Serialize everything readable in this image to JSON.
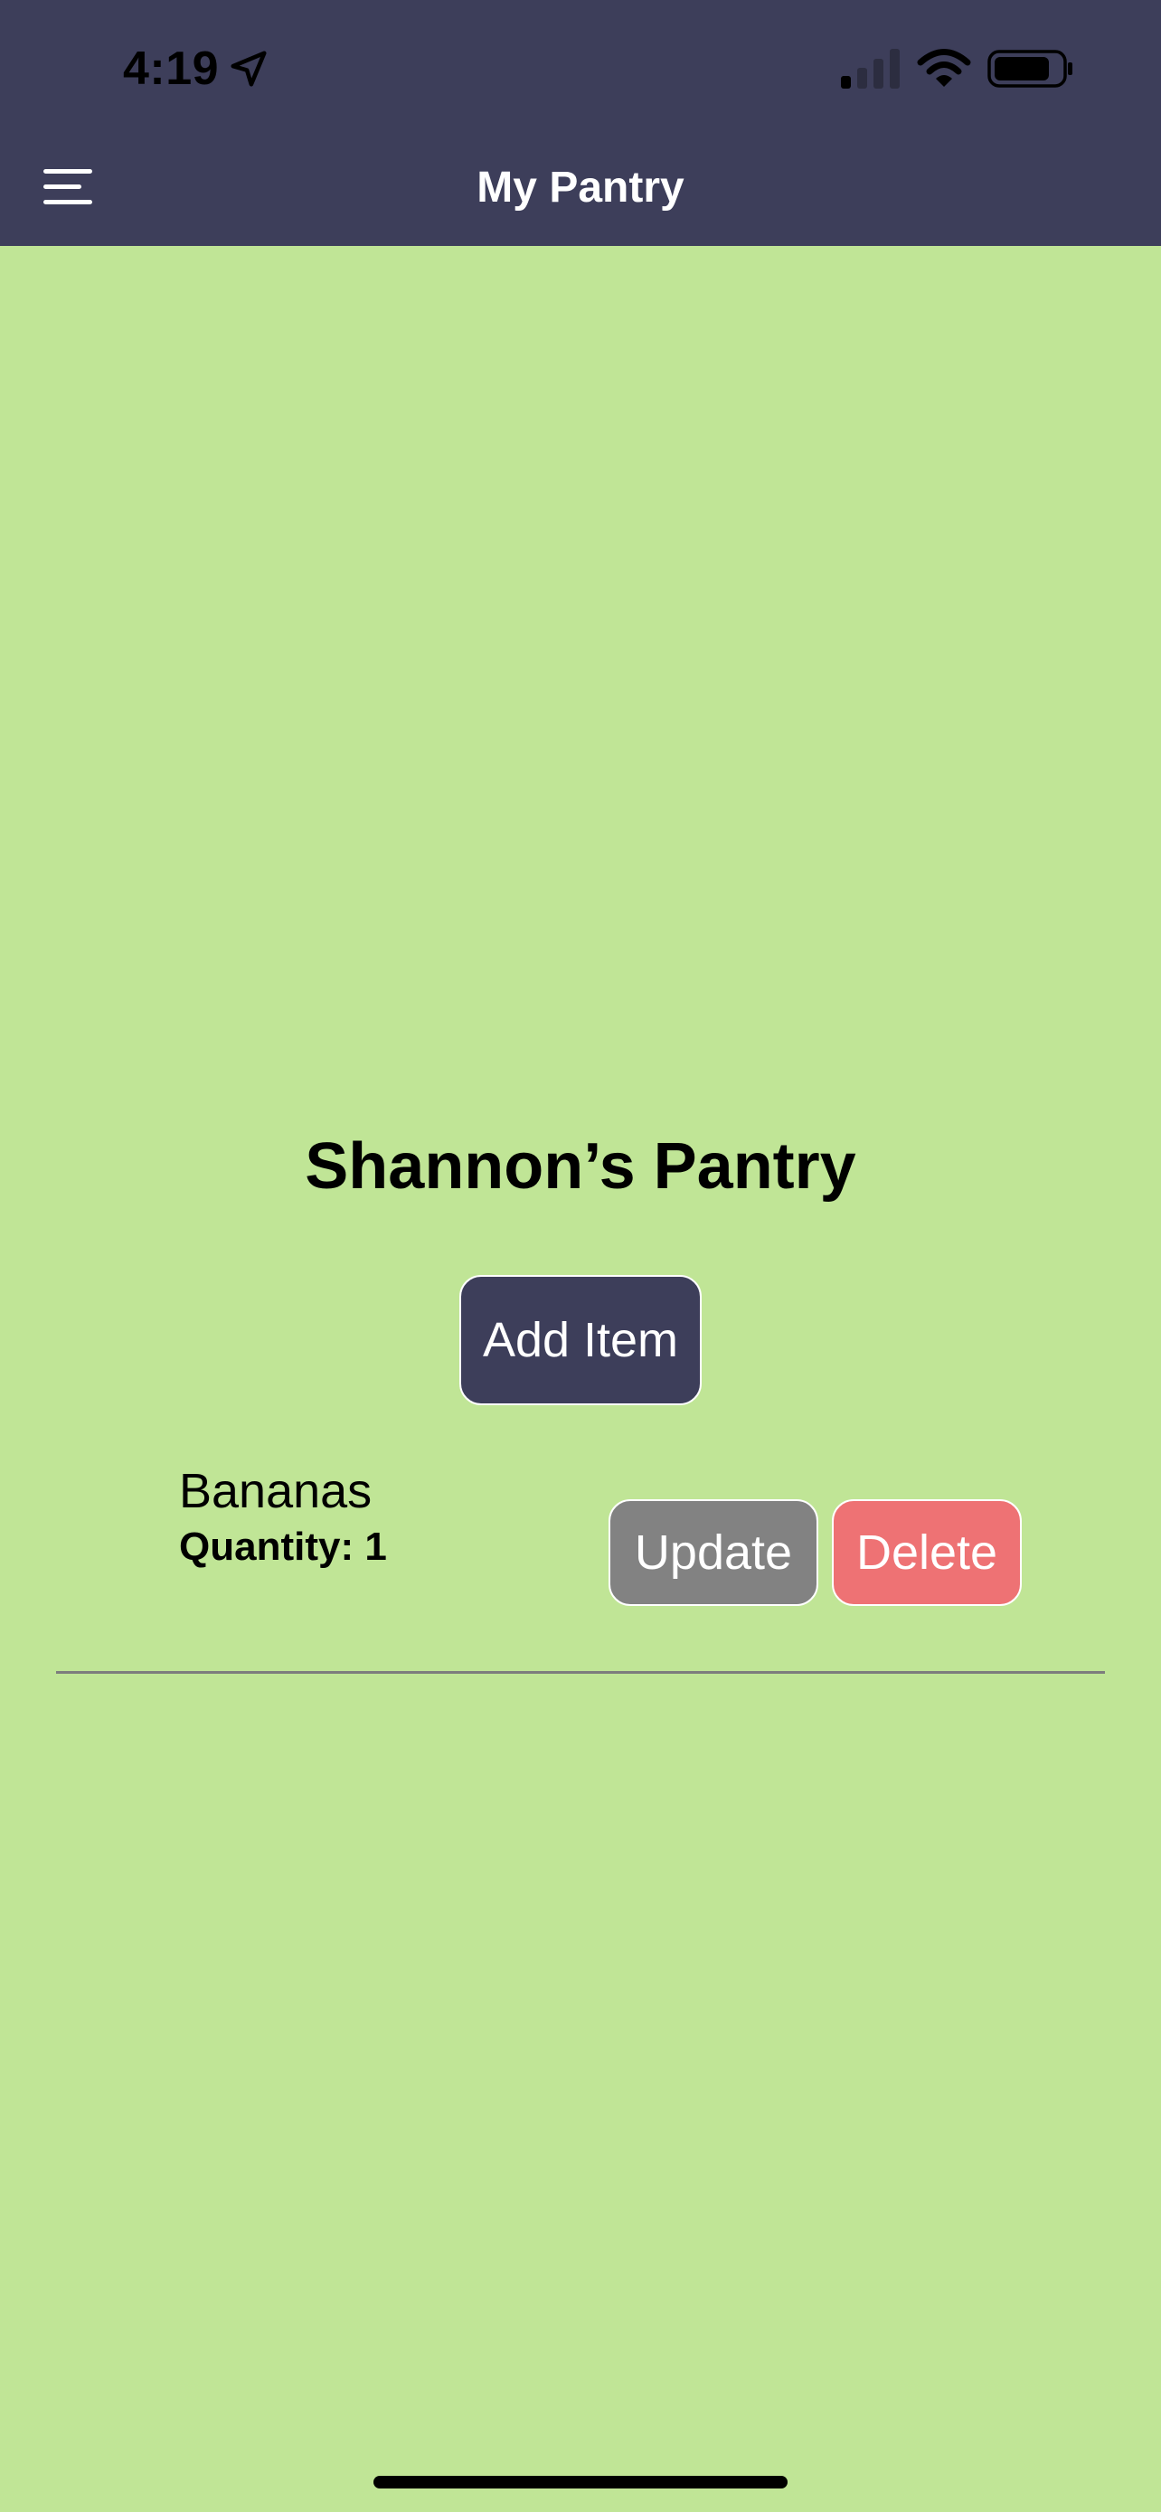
{
  "status_bar": {
    "time": "4:19",
    "location_icon": "location-arrow-icon",
    "signal_icon": "cellular-signal-icon",
    "wifi_icon": "wifi-icon",
    "battery_icon": "battery-icon"
  },
  "header": {
    "title": "My Pantry",
    "menu_icon": "hamburger-menu-icon",
    "background_color": "#3d3e5a"
  },
  "main": {
    "pantry_title": "Shannon’s Pantry",
    "add_item_label": "Add Item",
    "background_color": "#c0e596",
    "items": [
      {
        "name": "Bananas",
        "quantity_label": "Quantity: 1",
        "update_label": "Update",
        "delete_label": "Delete"
      }
    ]
  },
  "colors": {
    "accent": "#3d3e5a",
    "update": "#828282",
    "delete": "#ee7274"
  }
}
